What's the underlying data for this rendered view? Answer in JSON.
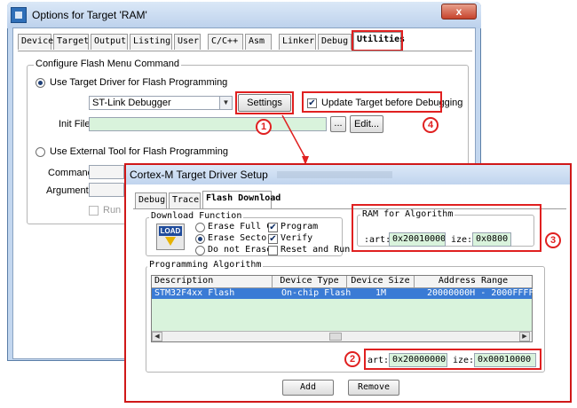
{
  "outer": {
    "title": "Options for Target 'RAM'",
    "close_glyph": "x",
    "tabs": [
      "Device",
      "Target",
      "Output",
      "Listing",
      "User",
      "C/C++",
      "Asm",
      "Linker",
      "Debug",
      "Utilities"
    ],
    "active_tab": "Utilities",
    "group_title": "Configure Flash Menu Command",
    "use_target_driver": "Use Target Driver for Flash Programming",
    "driver_value": "ST-Link Debugger",
    "settings_button": "Settings",
    "update_target_label": "Update Target before Debugging",
    "update_target_checked": true,
    "init_file_label": "Init File:",
    "browse_button": "...",
    "edit_button": "Edit...",
    "use_external": "Use External Tool for Flash Programming",
    "command_label": "Command:",
    "arguments_label": "Arguments:",
    "run_independent": "Run In"
  },
  "inner": {
    "title": "Cortex-M Target Driver Setup",
    "tabs": [
      "Debug",
      "Trace",
      "Flash Download"
    ],
    "active_tab": "Flash Download",
    "download_group": "Download Function",
    "icon_label": "LOAD",
    "erase_full": "Erase Full C",
    "erase_sector": "Erase Sector",
    "do_not_erase": "Do not Erase",
    "program": "Program",
    "verify": "Verify",
    "reset_run": "Reset and Run",
    "ram_group": "RAM for Algorithm",
    "ram_start_label": ":art:",
    "ram_start_value": "0x20010000",
    "ram_size_label": "ize:",
    "ram_size_value": "0x0800",
    "prog_group": "Programming Algorithm",
    "columns": [
      "Description",
      "Device Type",
      "Device Size",
      "Address Range"
    ],
    "rows": [
      {
        "description": "STM32F4xx Flash",
        "type": "On-chip Flash",
        "size": "1M",
        "range": "20000000H - 2000FFFFH"
      }
    ],
    "start_label": "art:",
    "start_value": "0x20000000",
    "size_label": "ize:",
    "size_value": "0x00010000",
    "add_button": "Add",
    "remove_button": "Remove"
  },
  "annotations": {
    "n1": "1",
    "n2": "2",
    "n3": "3",
    "n4": "4",
    "color": "#e02020"
  }
}
